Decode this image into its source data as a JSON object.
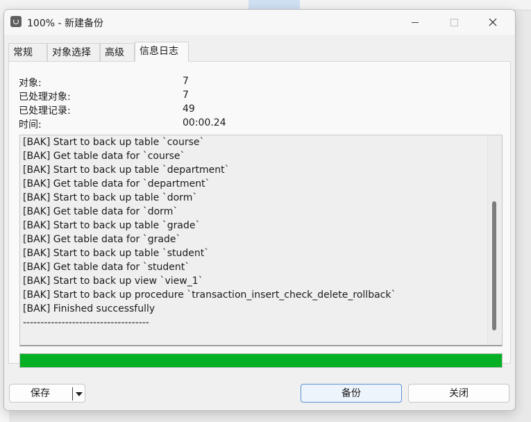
{
  "window": {
    "title": "100% - 新建备份",
    "controls": [
      "minimize",
      "maximize",
      "close"
    ]
  },
  "tabs": [
    {
      "label": "常规",
      "active": false
    },
    {
      "label": "对象选择",
      "active": false
    },
    {
      "label": "高级",
      "active": false
    },
    {
      "label": "信息日志",
      "active": true
    }
  ],
  "stats": [
    {
      "label": "对象:",
      "value": "7"
    },
    {
      "label": "已处理对象:",
      "value": "7"
    },
    {
      "label": "已处理记录:",
      "value": "49"
    },
    {
      "label": "时间:",
      "value": "00:00.24"
    }
  ],
  "log": [
    "[BAK] Start to back up table `course`",
    "[BAK] Get table data for `course`",
    "[BAK] Start to back up table `department`",
    "[BAK] Get table data for `department`",
    "[BAK] Start to back up table `dorm`",
    "[BAK] Get table data for `dorm`",
    "[BAK] Start to back up table `grade`",
    "[BAK] Get table data for `grade`",
    "[BAK] Start to back up table `student`",
    "[BAK] Get table data for `student`",
    "[BAK] Start to back up view `view_1`",
    "[BAK] Start to back up procedure `transaction_insert_check_delete_rollback`",
    "[BAK] Finished successfully",
    "------------------------------------"
  ],
  "progress": {
    "percent": 100,
    "color": "#06b025"
  },
  "buttons": {
    "save": "保存",
    "backup": "备份",
    "close": "关闭"
  },
  "icons": {
    "app": "navicat-backup-icon",
    "dropdown": "chevron-down-icon"
  }
}
